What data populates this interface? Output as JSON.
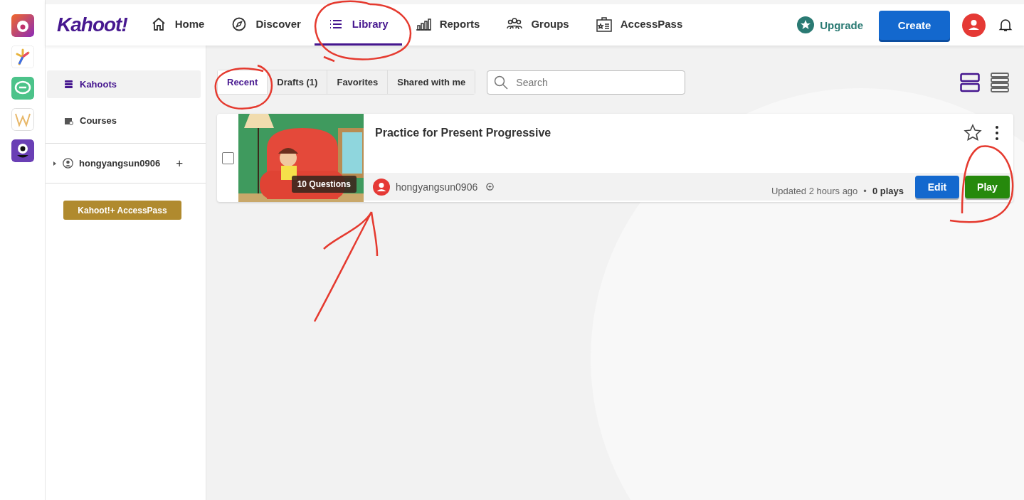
{
  "nav": {
    "logo": "Kahoot!",
    "items": [
      {
        "label": "Home",
        "selected": false
      },
      {
        "label": "Discover",
        "selected": false
      },
      {
        "label": "Library",
        "selected": true
      },
      {
        "label": "Reports",
        "selected": false
      },
      {
        "label": "Groups",
        "selected": false
      },
      {
        "label": "AccessPass",
        "selected": false
      }
    ],
    "upgrade": "Upgrade",
    "create": "Create"
  },
  "sidebar": {
    "items": [
      {
        "label": "Kahoots",
        "selected": true
      },
      {
        "label": "Courses",
        "selected": false
      }
    ],
    "account": {
      "name": "hongyangsun0906",
      "expanded": false,
      "add": "+"
    },
    "accesspass": "Kahoot!+ AccessPass"
  },
  "filters": {
    "tabs": [
      {
        "label": "Recent",
        "selected": true
      },
      {
        "label": "Drafts (1)",
        "selected": false
      },
      {
        "label": "Favorites",
        "selected": false
      },
      {
        "label": "Shared with me",
        "selected": false
      }
    ],
    "search": {
      "placeholder": "Search"
    },
    "views": [
      {
        "kind": "cards",
        "selected": true
      },
      {
        "kind": "list",
        "selected": false
      }
    ]
  },
  "kahoots": [
    {
      "title": "Practice for Present Progressive",
      "questions": "10 Questions",
      "owner": "hongyangsun0906",
      "updated": "Updated 2 hours ago",
      "separator": "•",
      "plays": "0 plays",
      "checked": false,
      "favorite": false,
      "edit": "Edit",
      "play": "Play"
    }
  ]
}
